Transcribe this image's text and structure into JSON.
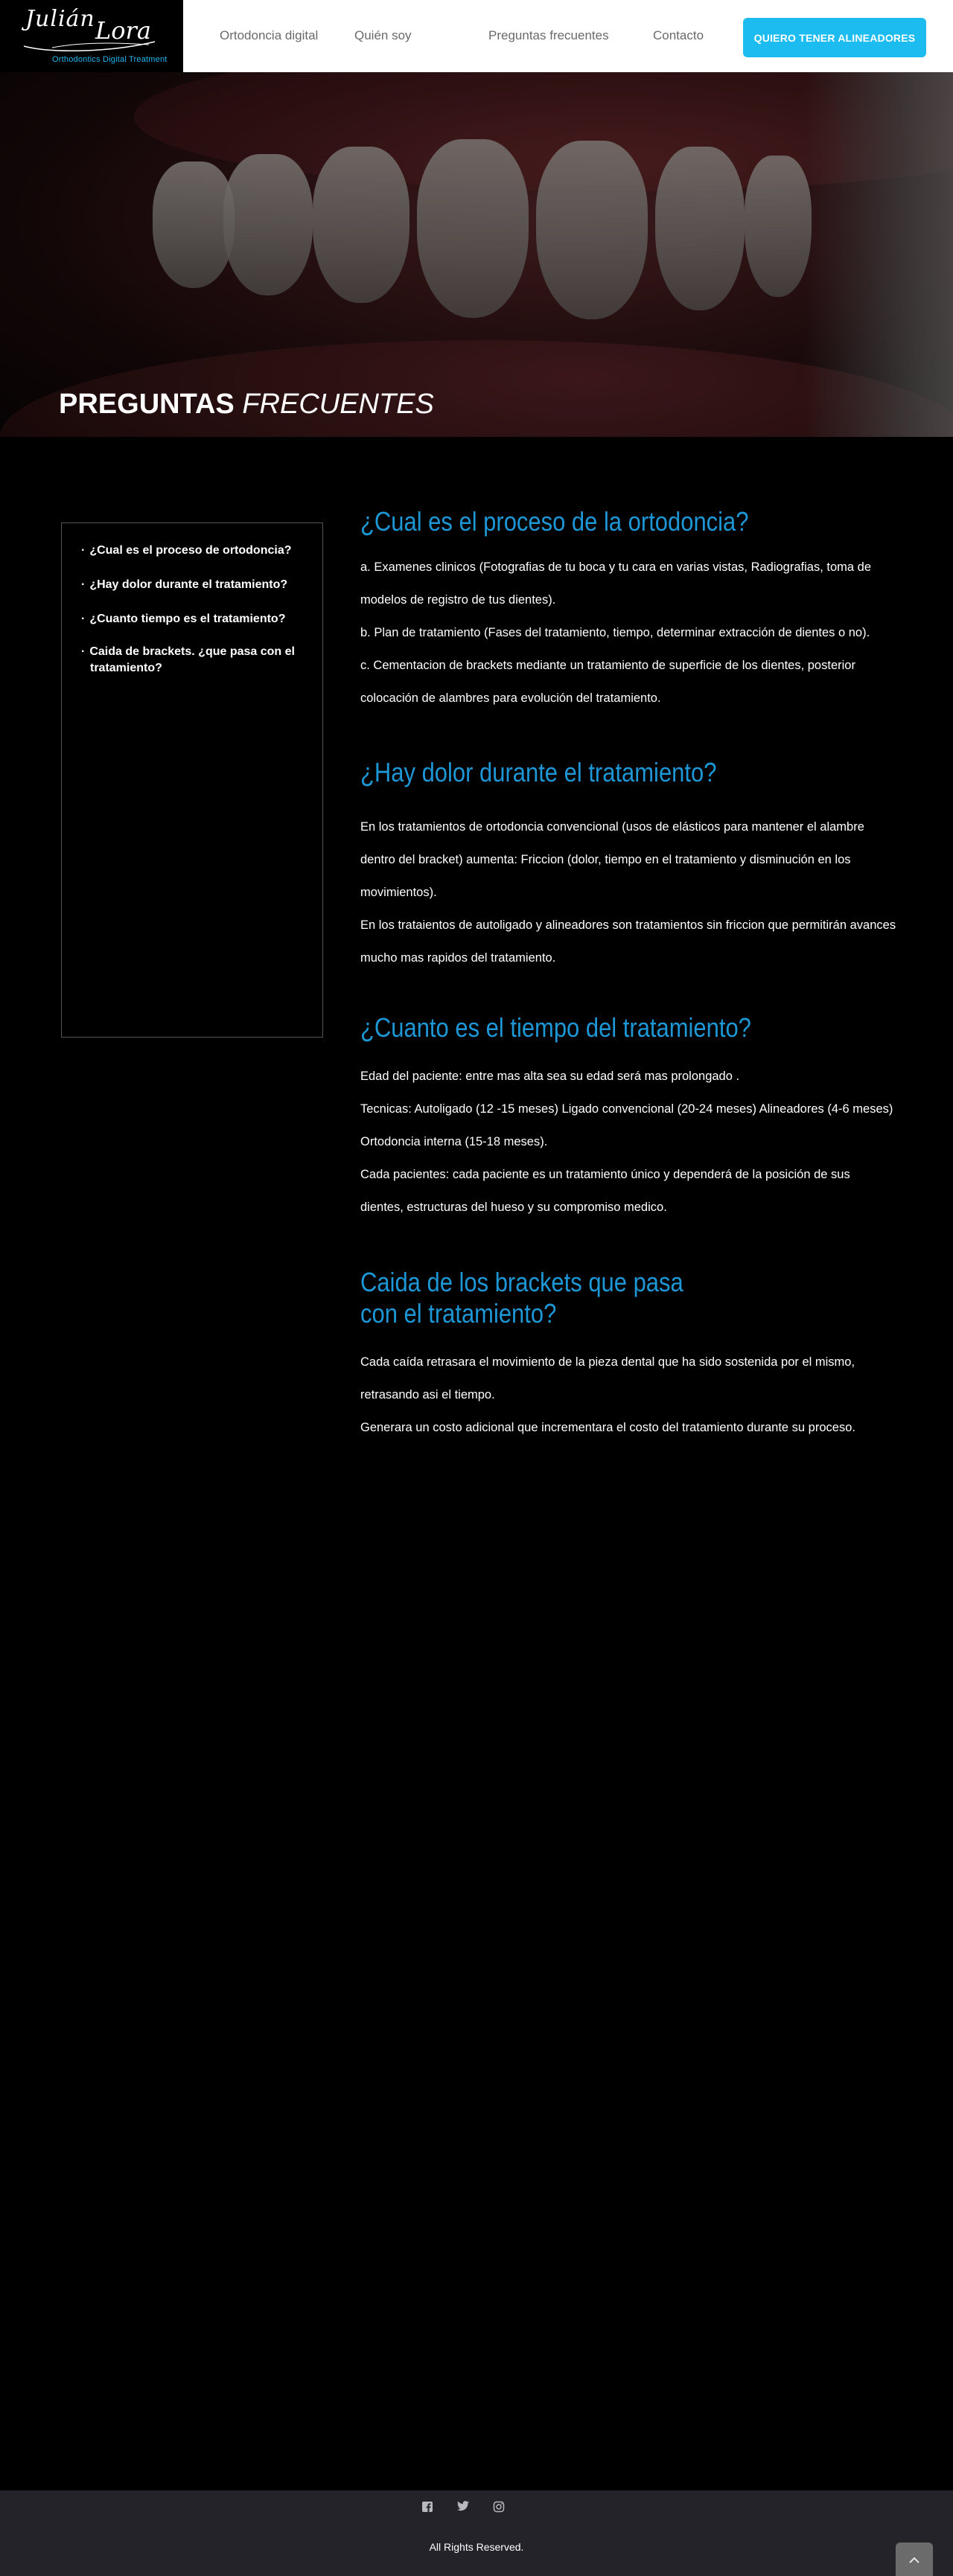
{
  "brand": {
    "logo_script_first": "Julián",
    "logo_script_last": "Lora",
    "logo_tagline": "Orthodontics Digital Treatment"
  },
  "nav": {
    "items": [
      {
        "label": "Ortodoncia digital"
      },
      {
        "label": "Quién soy"
      },
      {
        "label": "Preguntas frecuentes"
      },
      {
        "label": "Contacto"
      }
    ],
    "cta_label": "QUIERO TENER ALINEADORES"
  },
  "hero": {
    "title_bold": "PREGUNTAS",
    "title_italic": "FRECUENTES"
  },
  "toc": {
    "items": [
      "¿Cual es el proceso de ortodoncia?",
      "¿Hay dolor durante el tratamiento?",
      "¿Cuanto tiempo es el tratamiento?",
      "Caida de brackets. ¿que pasa con el tratamiento?"
    ]
  },
  "sections": [
    {
      "title": "¿Cual es el proceso de la ortodoncia?",
      "paragraphs": [
        "a. Examenes clinicos (Fotografias de tu boca y tu cara en varias vistas, Radiografias, toma de modelos de registro de tus dientes).",
        "b. Plan de tratamiento (Fases del tratamiento, tiempo, determinar extracción de dientes o no).",
        "c. Cementacion de brackets mediante un tratamiento de superficie de los dientes, posterior colocación de alambres para evolución del tratamiento."
      ]
    },
    {
      "title": "¿Hay dolor durante el tratamiento?",
      "paragraphs": [
        "En los tratamientos de ortodoncia convencional (usos de elásticos para mantener el alambre dentro del bracket) aumenta: Friccion (dolor, tiempo en el tratamiento y disminución en los movimientos).",
        "En los trataientos de autoligado y alineadores son tratamientos sin friccion que permitirán avances mucho mas rapidos del tratamiento."
      ]
    },
    {
      "title": "¿Cuanto es el tiempo del tratamiento?",
      "paragraphs": [
        "Edad del paciente: entre mas alta sea su edad será mas prolongado .",
        "Tecnicas: Autoligado (12 -15 meses) Ligado convencional (20-24 meses) Alineadores (4-6 meses) Ortodoncia interna (15-18 meses).",
        "Cada pacientes: cada paciente es un tratamiento único y dependerá de la posición de sus dientes, estructuras del hueso y su compromiso medico."
      ]
    },
    {
      "title": "Caida de los brackets que pasa con el tratamiento?",
      "paragraphs": [
        "Cada caída retrasara el movimiento de la pieza dental que ha sido sostenida por el mismo, retrasando asi el tiempo.",
        "Generara un costo adicional que incrementara el costo del tratamiento durante su proceso."
      ]
    }
  ],
  "footer": {
    "social_icons": [
      "facebook-icon",
      "twitter-icon",
      "instagram-icon"
    ],
    "rights": "All Rights Reserved.",
    "back_to_top_icon": "chevron-up-icon"
  },
  "colors": {
    "accent": "#1cbcf0",
    "heading": "#1d97d6",
    "footer_bg": "#24232a"
  }
}
